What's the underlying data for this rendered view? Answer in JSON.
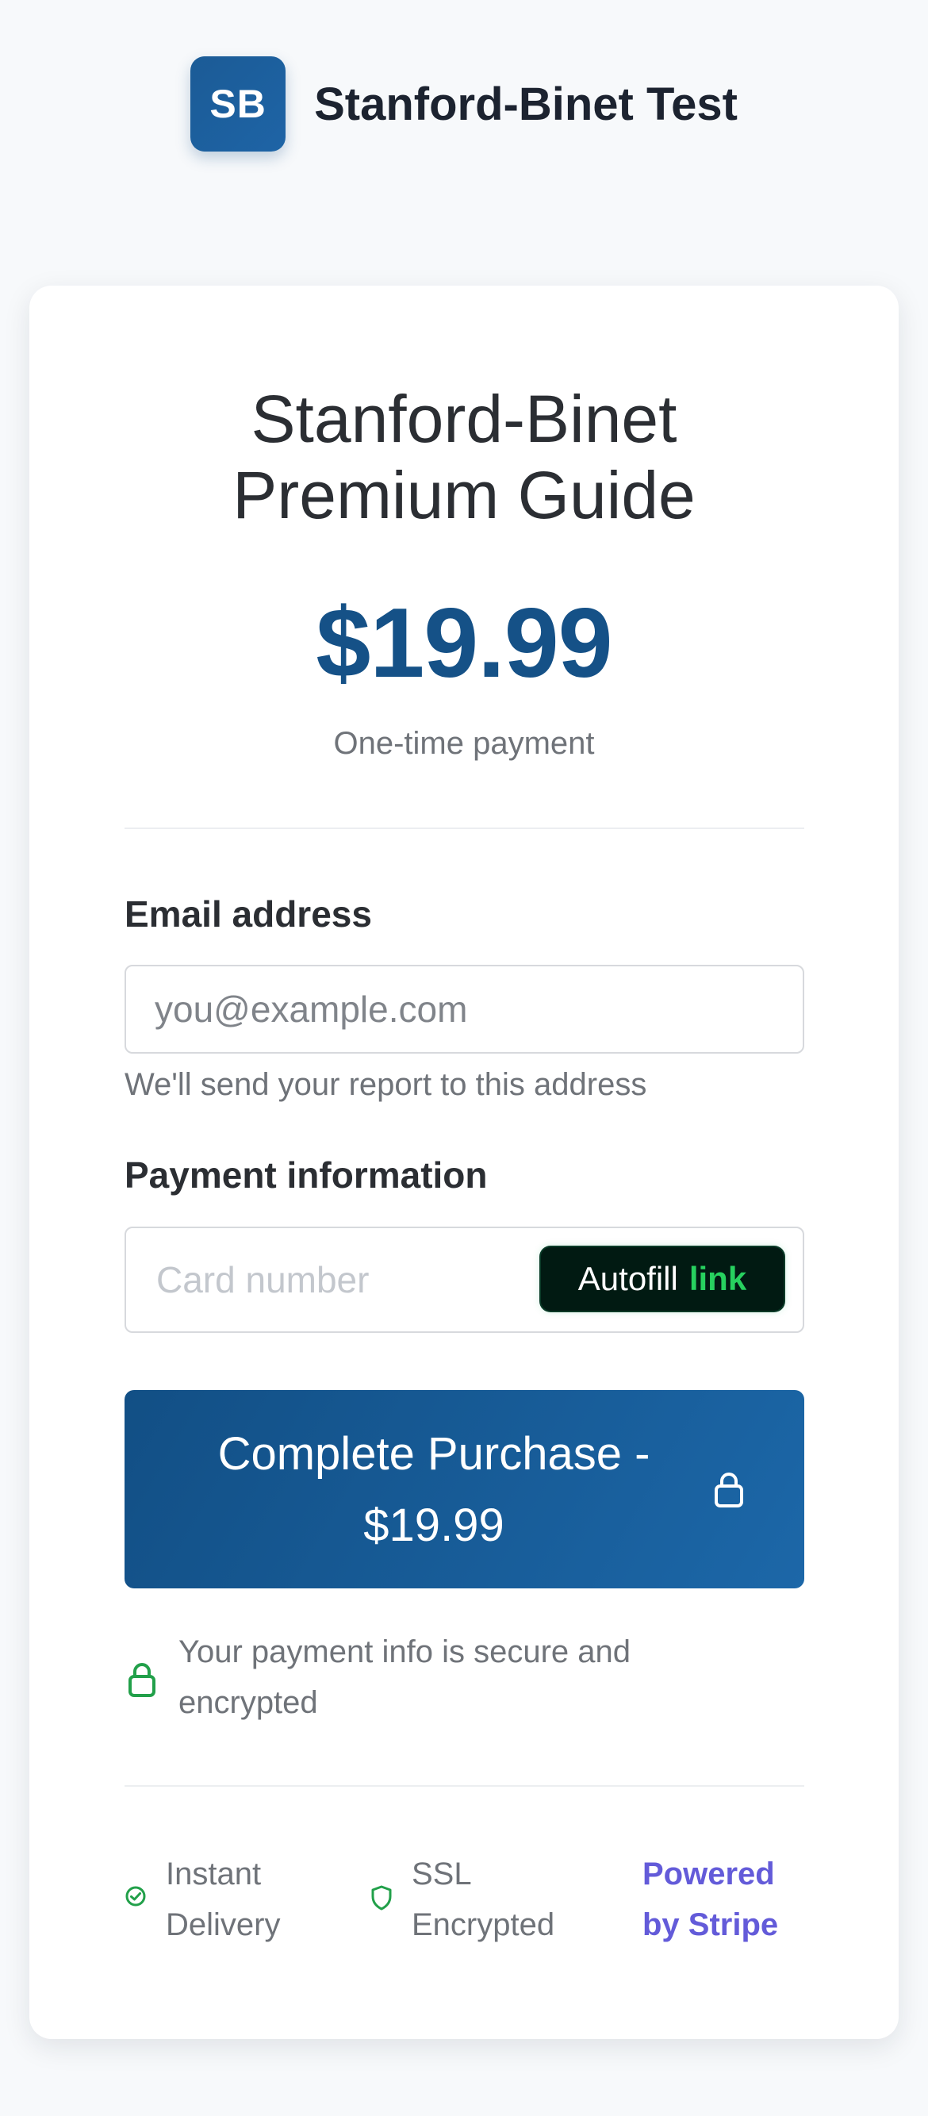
{
  "brand": {
    "logo_text": "SB",
    "name": "Stanford-Binet Test"
  },
  "product": {
    "title_line1": "Stanford-Binet",
    "title_line2": "Premium Guide",
    "price": "$19.99",
    "price_note": "One-time payment"
  },
  "form": {
    "email_label": "Email address",
    "email_placeholder": "you@example.com",
    "email_value": "",
    "email_help": "We'll send your report to this address",
    "payment_label": "Payment information",
    "card_placeholder": "Card number",
    "autofill_text": "Autofill",
    "autofill_link": "link"
  },
  "purchase": {
    "line1": "Complete Purchase -",
    "line2": "$19.99",
    "icon": "lock-icon"
  },
  "security": {
    "line1": "Your payment info is secure and",
    "line2": "encrypted",
    "icon": "lock-icon"
  },
  "badges": {
    "instant_line1": "Instant",
    "instant_line2": "Delivery",
    "instant_icon": "check-circle-icon",
    "ssl_line1": "SSL",
    "ssl_line2": "Encrypted",
    "ssl_icon": "shield-icon",
    "stripe_line1": "Powered",
    "stripe_line2": "by Stripe"
  },
  "colors": {
    "brand_blue": "#155187",
    "secure_green": "#22a04a",
    "stripe_purple": "#635bd9",
    "background": "#f7f9fb"
  }
}
